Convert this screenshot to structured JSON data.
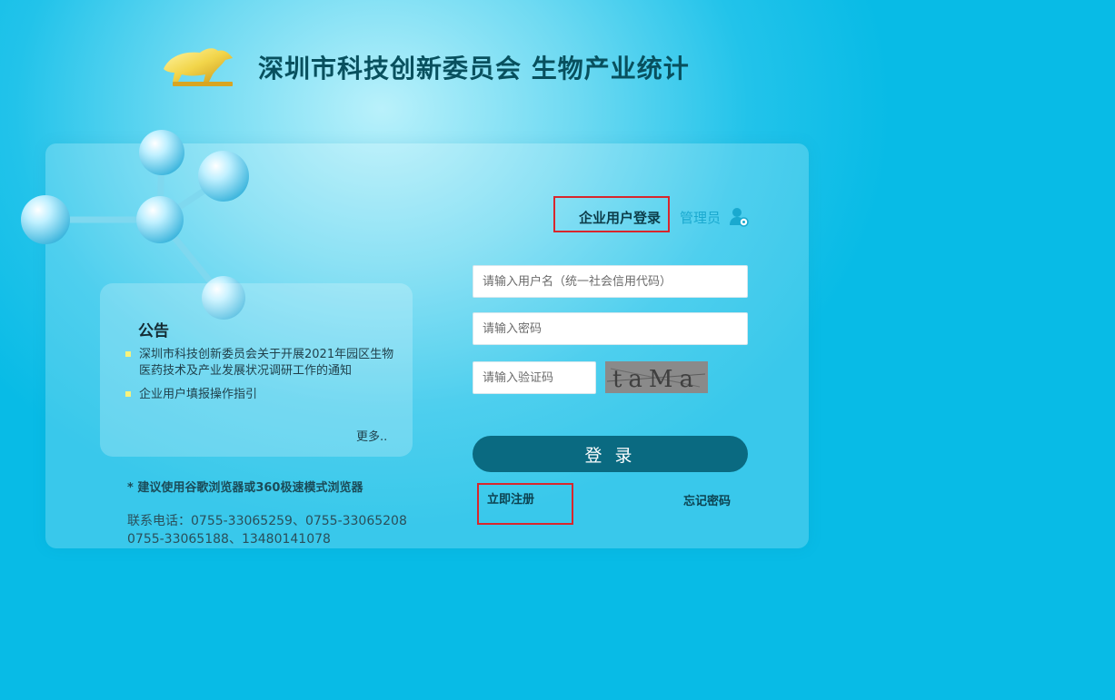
{
  "header": {
    "title": "深圳市科技创新委员会 生物产业统计",
    "logo_icon": "golden-bull-logo"
  },
  "notice": {
    "title": "公告",
    "items": [
      "深圳市科技创新委员会关于开展2021年园区生物医药技术及产业发展状况调研工作的通知",
      "企业用户填报操作指引"
    ],
    "more": "更多.."
  },
  "footer": {
    "browser_tip": "* 建议使用谷歌浏览器或360极速模式浏览器",
    "contact_line1": "联系电话：0755-33065259、0755-33065208",
    "contact_line2": "0755-33065188、13480141078"
  },
  "login": {
    "tab_enterprise": "企业用户登录",
    "tab_admin": "管理员",
    "admin_icon": "user-settings-icon",
    "username_placeholder": "请输入用户名（统一社会信用代码）",
    "password_placeholder": "请输入密码",
    "captcha_placeholder": "请输入验证码",
    "captcha_text": "taMa",
    "login_button": "登 录",
    "register": "立即注册",
    "forgot_password": "忘记密码"
  },
  "colors": {
    "primary": "#0a6a81",
    "highlight_border": "#d8262c",
    "admin_tab": "#1aa9cf",
    "bullet": "#f7f27c"
  }
}
